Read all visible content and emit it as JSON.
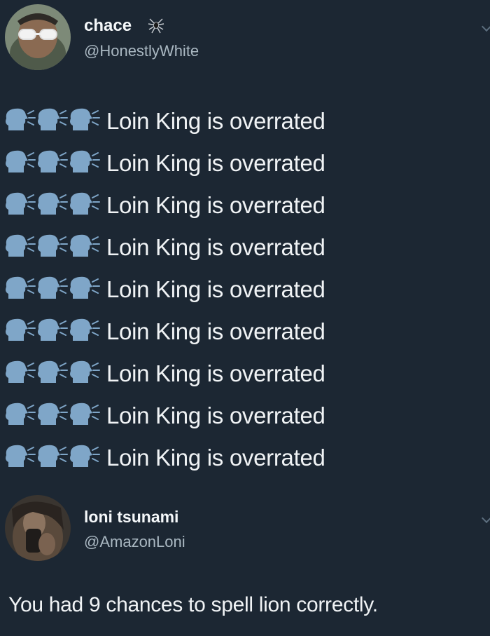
{
  "tweet": {
    "author_name": "chace",
    "badge_icon": "spider-icon",
    "author_handle": "@HonestlyWhite",
    "emoji_icon": "speaking-head-icon",
    "lines": [
      "Loin King is overrated",
      "Loin King is overrated",
      "Loin King is overrated",
      "Loin King is overrated",
      "Loin King is overrated",
      "Loin King is overrated",
      "Loin King is overrated",
      "Loin King is overrated",
      "Loin King is overrated"
    ]
  },
  "reply": {
    "author_name": "loni tsunami",
    "author_handle": "@AmazonLoni",
    "text": "You had 9 chances to spell lion correctly."
  },
  "colors": {
    "background": "#1c2733",
    "text": "#e8ecef",
    "handle": "#aab8c2",
    "emoji": "#7fa6c8"
  }
}
